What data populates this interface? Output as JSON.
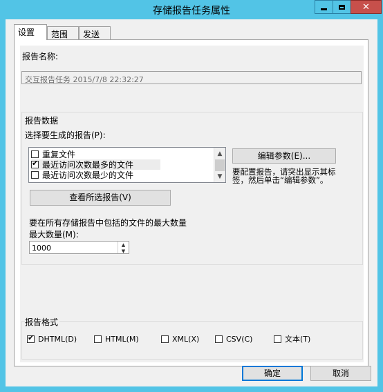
{
  "window": {
    "title": "存储报告任务属性",
    "close_glyph": "✕"
  },
  "tabs": [
    {
      "label": "设置",
      "active": true
    },
    {
      "label": "范围",
      "active": false
    },
    {
      "label": "发送",
      "active": false
    }
  ],
  "report_name": {
    "label": "报告名称:",
    "value": "交互报告任务 2015/7/8 22:32:27"
  },
  "report_data": {
    "group_label": "报告数据",
    "select_label": "选择要生成的报告(P):",
    "items": [
      {
        "label": "重复文件",
        "checked": false
      },
      {
        "label": "最近访问次数最多的文件",
        "checked": true
      },
      {
        "label": "最近访问次数最少的文件",
        "checked": false
      }
    ],
    "edit_params_button": "编辑参数(E)...",
    "hint": "要配置报告，请突出显示其标签，然后单击“编辑参数”。",
    "view_selected_button": "查看所选报告(V)",
    "max_files_desc": "要在所有存储报告中包括的文件的最大数量",
    "max_label": "最大数量(M):",
    "max_value": "1000"
  },
  "report_format": {
    "group_label": "报告格式",
    "options": [
      {
        "label": "DHTML(D)",
        "checked": true
      },
      {
        "label": "HTML(M)",
        "checked": false
      },
      {
        "label": "XML(X)",
        "checked": false
      },
      {
        "label": "CSV(C)",
        "checked": false
      },
      {
        "label": "文本(T)",
        "checked": false
      }
    ]
  },
  "footer": {
    "ok_label": "确定",
    "cancel_label": "取消"
  },
  "glyphs": {
    "check": "✔",
    "scroll_up": "▲",
    "scroll_down": "▼"
  },
  "colors": {
    "title_bar": "#52c4e6",
    "close_button": "#c7504b",
    "dialog_bg": "#f0f0f0",
    "focus_border": "#0078d7"
  }
}
